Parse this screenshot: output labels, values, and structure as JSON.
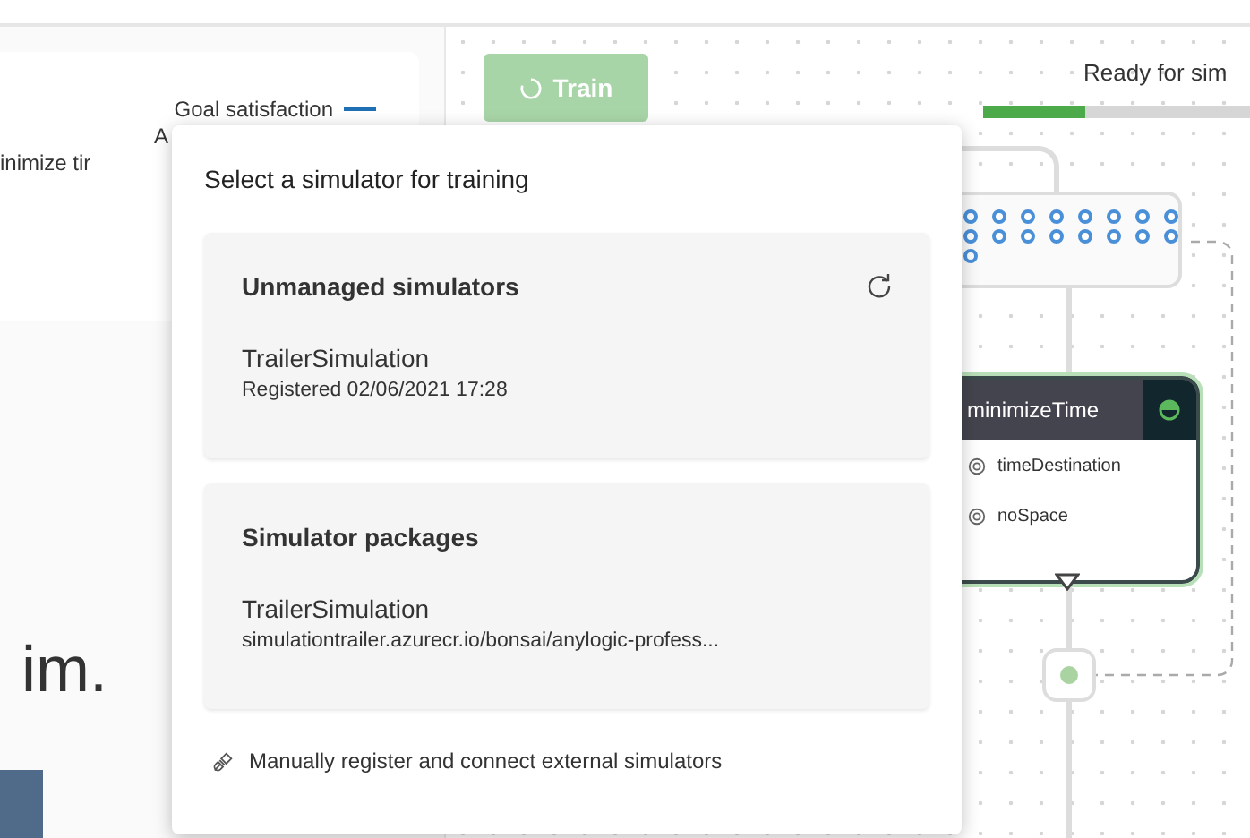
{
  "legend": {
    "items": [
      {
        "label": "Goal satisfaction",
        "color": "#1f6fb5"
      },
      {
        "label": "A"
      },
      {
        "label": "inimize tir"
      }
    ]
  },
  "heading_fragment": "im.",
  "train_button": {
    "label": "Train",
    "disabled": true
  },
  "status": {
    "text": "Ready for sim",
    "level": 0.38
  },
  "graph": {
    "concept_node": {
      "title": "minimizeTime",
      "items": [
        "timeDestination",
        "noSpace"
      ]
    }
  },
  "dialog": {
    "title": "Select a simulator for training",
    "sections": [
      {
        "title": "Unmanaged simulators",
        "refresh": true,
        "name": "TrailerSimulation",
        "detail": "Registered 02/06/2021 17:28"
      },
      {
        "title": "Simulator packages",
        "refresh": false,
        "name": "TrailerSimulation",
        "detail": "simulationtrailer.azurecr.io/bonsai/anylogic-profess..."
      }
    ],
    "footer_link": "Manually register and connect external simulators"
  }
}
